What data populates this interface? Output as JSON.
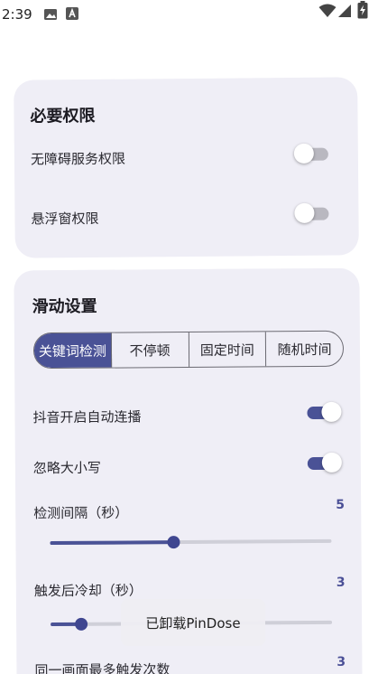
{
  "status_bar": {
    "time": "2:39",
    "icons": [
      "gallery-icon",
      "a-icon",
      "wifi-icon",
      "cell-signal-icon",
      "battery-charging-icon"
    ]
  },
  "permissions": {
    "title": "必要权限",
    "items": [
      {
        "label": "无障碍服务权限",
        "enabled": false
      },
      {
        "label": "悬浮窗权限",
        "enabled": false
      }
    ]
  },
  "slide_settings": {
    "title": "滑动设置",
    "modes": [
      "关键词检测",
      "不停顿",
      "固定时间",
      "随机时间"
    ],
    "selected_mode": "关键词检测",
    "toggles": [
      {
        "label": "抖音开启自动连播",
        "enabled": true
      },
      {
        "label": "忽略大小写",
        "enabled": true
      }
    ],
    "sliders": [
      {
        "label": "检测间隔（秒）",
        "value": "5",
        "fraction": 0.44
      },
      {
        "label": "触发后冷却（秒）",
        "value": "3",
        "fraction": 0.11
      }
    ],
    "partial_row": {
      "label": "同一画面最多触发次数",
      "value": "3"
    }
  },
  "toast": {
    "text": "已卸载PinDose"
  },
  "colors": {
    "accent": "#4a5296",
    "card": "#efeef6",
    "track_off": "#b9b8c0"
  }
}
